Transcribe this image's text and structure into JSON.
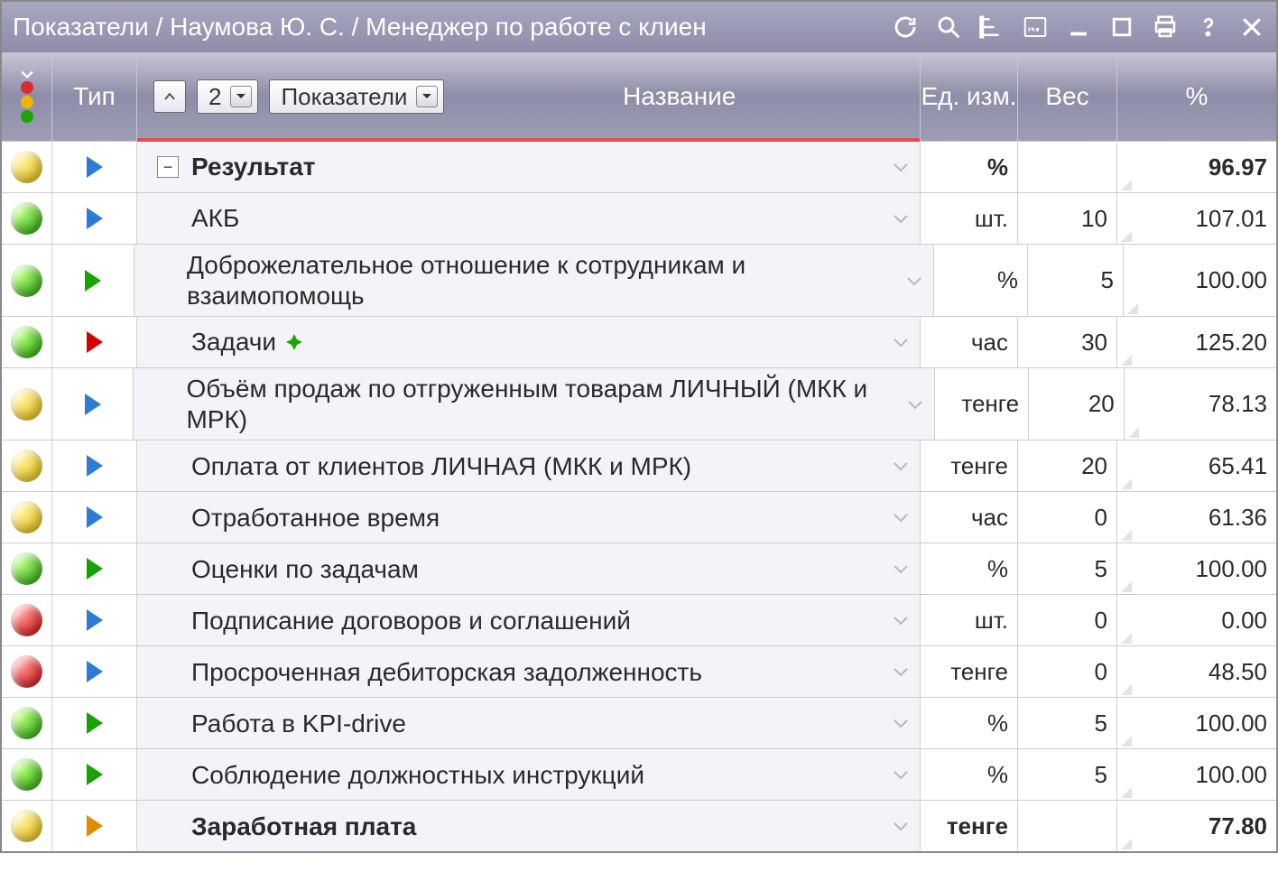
{
  "title": "Показатели / Наумова Ю. С. / Менеджер по работе с клиен",
  "header": {
    "type": "Тип",
    "name": "Название",
    "unit": "Ед. изм.",
    "weight": "Вес",
    "pct": "%",
    "level_value": "2",
    "filter_value": "Показатели"
  },
  "rows": [
    {
      "status": "yellow",
      "type": "blue",
      "label": "Результат",
      "unit": "%",
      "weight": "",
      "pct": "96.97",
      "bold": true,
      "expander": true,
      "indent": 0
    },
    {
      "status": "green",
      "type": "blue",
      "label": "АКБ",
      "unit": "шт.",
      "weight": "10",
      "pct": "107.01",
      "indent": 1
    },
    {
      "status": "green",
      "type": "green",
      "label": "Доброжелательное отношение к сотрудникам и взаимопомощь",
      "unit": "%",
      "weight": "5",
      "pct": "100.00",
      "indent": 1
    },
    {
      "status": "green",
      "type": "red",
      "label": "Задачи",
      "unit": "час",
      "weight": "30",
      "pct": "125.20",
      "indent": 1,
      "marker": true
    },
    {
      "status": "yellow",
      "type": "blue",
      "label": "Объём продаж по отгруженным товарам ЛИЧНЫЙ (МКК и МРК)",
      "unit": "тенге",
      "weight": "20",
      "pct": "78.13",
      "indent": 1
    },
    {
      "status": "yellow",
      "type": "blue",
      "label": "Оплата от клиентов ЛИЧНАЯ (МКК и МРК)",
      "unit": "тенге",
      "weight": "20",
      "pct": "65.41",
      "indent": 1
    },
    {
      "status": "yellow",
      "type": "blue",
      "label": "Отработанное время",
      "unit": "час",
      "weight": "0",
      "pct": "61.36",
      "indent": 1
    },
    {
      "status": "green",
      "type": "green",
      "label": "Оценки по задачам",
      "unit": "%",
      "weight": "5",
      "pct": "100.00",
      "indent": 1
    },
    {
      "status": "red",
      "type": "blue",
      "label": "Подписание договоров и соглашений",
      "unit": "шт.",
      "weight": "0",
      "pct": "0.00",
      "indent": 1
    },
    {
      "status": "red",
      "type": "blue",
      "label": "Просроченная дебиторская задолженность",
      "unit": "тенге",
      "weight": "0",
      "pct": "48.50",
      "indent": 1
    },
    {
      "status": "green",
      "type": "green",
      "label": "Работа в KPI-drive",
      "unit": "%",
      "weight": "5",
      "pct": "100.00",
      "indent": 1
    },
    {
      "status": "green",
      "type": "green",
      "label": "Соблюдение должностных инструкций",
      "unit": "%",
      "weight": "5",
      "pct": "100.00",
      "indent": 1
    },
    {
      "status": "yellow",
      "type": "orange",
      "label": "Заработная плата",
      "unit": "тенге",
      "weight": "",
      "pct": "77.80",
      "bold": true,
      "indent": 1
    }
  ]
}
